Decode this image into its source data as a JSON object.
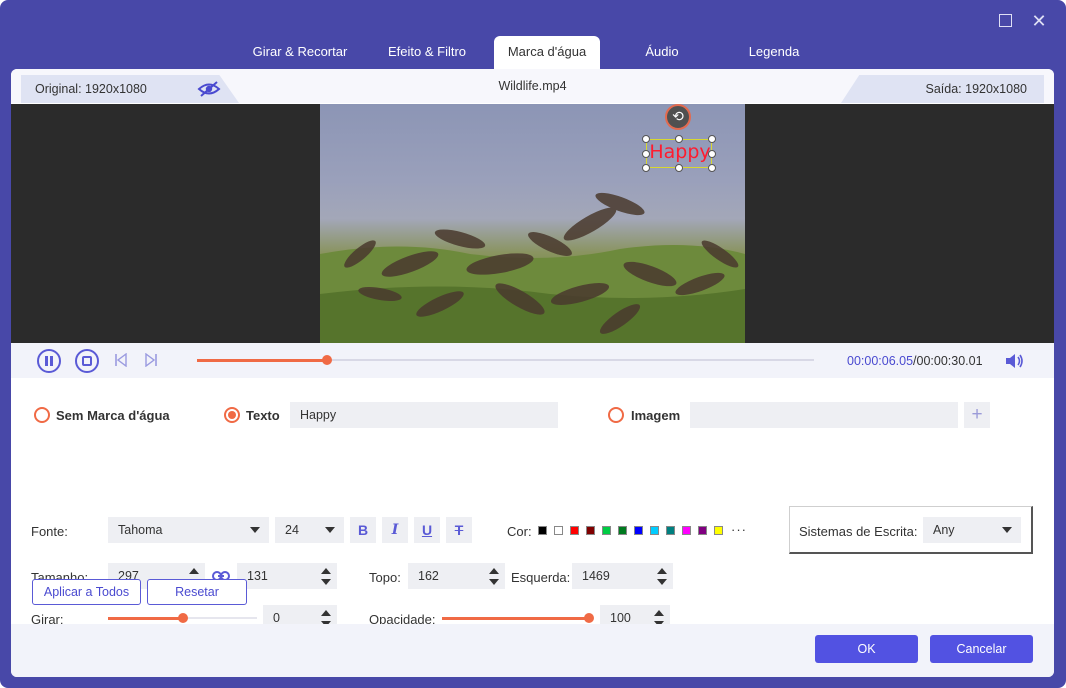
{
  "window": {
    "maximize_icon": "maximize-icon",
    "close_icon": "close-icon",
    "close_glyph": "✕"
  },
  "tabs": [
    {
      "label": "Girar & Recortar",
      "active": false
    },
    {
      "label": "Efeito & Filtro",
      "active": false
    },
    {
      "label": "Marca d'água",
      "active": true
    },
    {
      "label": "Áudio",
      "active": false
    },
    {
      "label": "Legenda",
      "active": false
    }
  ],
  "infobar": {
    "original": "Original: 1920x1080",
    "filename": "Wildlife.mp4",
    "output": "Saída: 1920x1080",
    "eye_icon": "eye-hidden-icon"
  },
  "preview": {
    "watermark_text": "Happy",
    "watermark_color": "#ff1b2e",
    "rotate_glyph": "⟲"
  },
  "player": {
    "current_time": "00:00:06.05",
    "total_time": "/00:00:30.01",
    "progress": 0.211,
    "accent": "#f06a45"
  },
  "watermark": {
    "none_label": "Sem Marca d'água",
    "text_label": "Texto",
    "text_value": "Happy",
    "image_label": "Imagem",
    "image_value": "",
    "plus_glyph": "+",
    "selected": "text"
  },
  "font": {
    "label": "Fonte:",
    "family": "Tahoma",
    "size": "24",
    "bold": "B",
    "italic": "I",
    "underline": "U",
    "strike": "T"
  },
  "color": {
    "label": "Cor:",
    "swatches": [
      "#000000",
      "#ffffff",
      "#ff0000",
      "#800000",
      "#00cc44",
      "#007a1f",
      "#0000ff",
      "#00ccff",
      "#008080",
      "#ff00ff",
      "#800080",
      "#ffff00"
    ],
    "more": "···"
  },
  "writing": {
    "label": "Sistemas de Escrita:",
    "value": "Any"
  },
  "size": {
    "label": "Tamanho:",
    "width": "297",
    "height": "131",
    "link_icon": "link-icon"
  },
  "position": {
    "top_label": "Topo:",
    "top": "162",
    "left_label": "Esquerda:",
    "left": "1469"
  },
  "rotate": {
    "label": "Girar:",
    "value": "0",
    "slider_fraction": 0.5
  },
  "opacity": {
    "label": "Opacidade:",
    "value": "100",
    "slider_fraction": 1.0
  },
  "actions": {
    "apply_all": "Aplicar a Todos",
    "reset": "Resetar"
  },
  "footer": {
    "ok": "OK",
    "cancel": "Cancelar"
  }
}
